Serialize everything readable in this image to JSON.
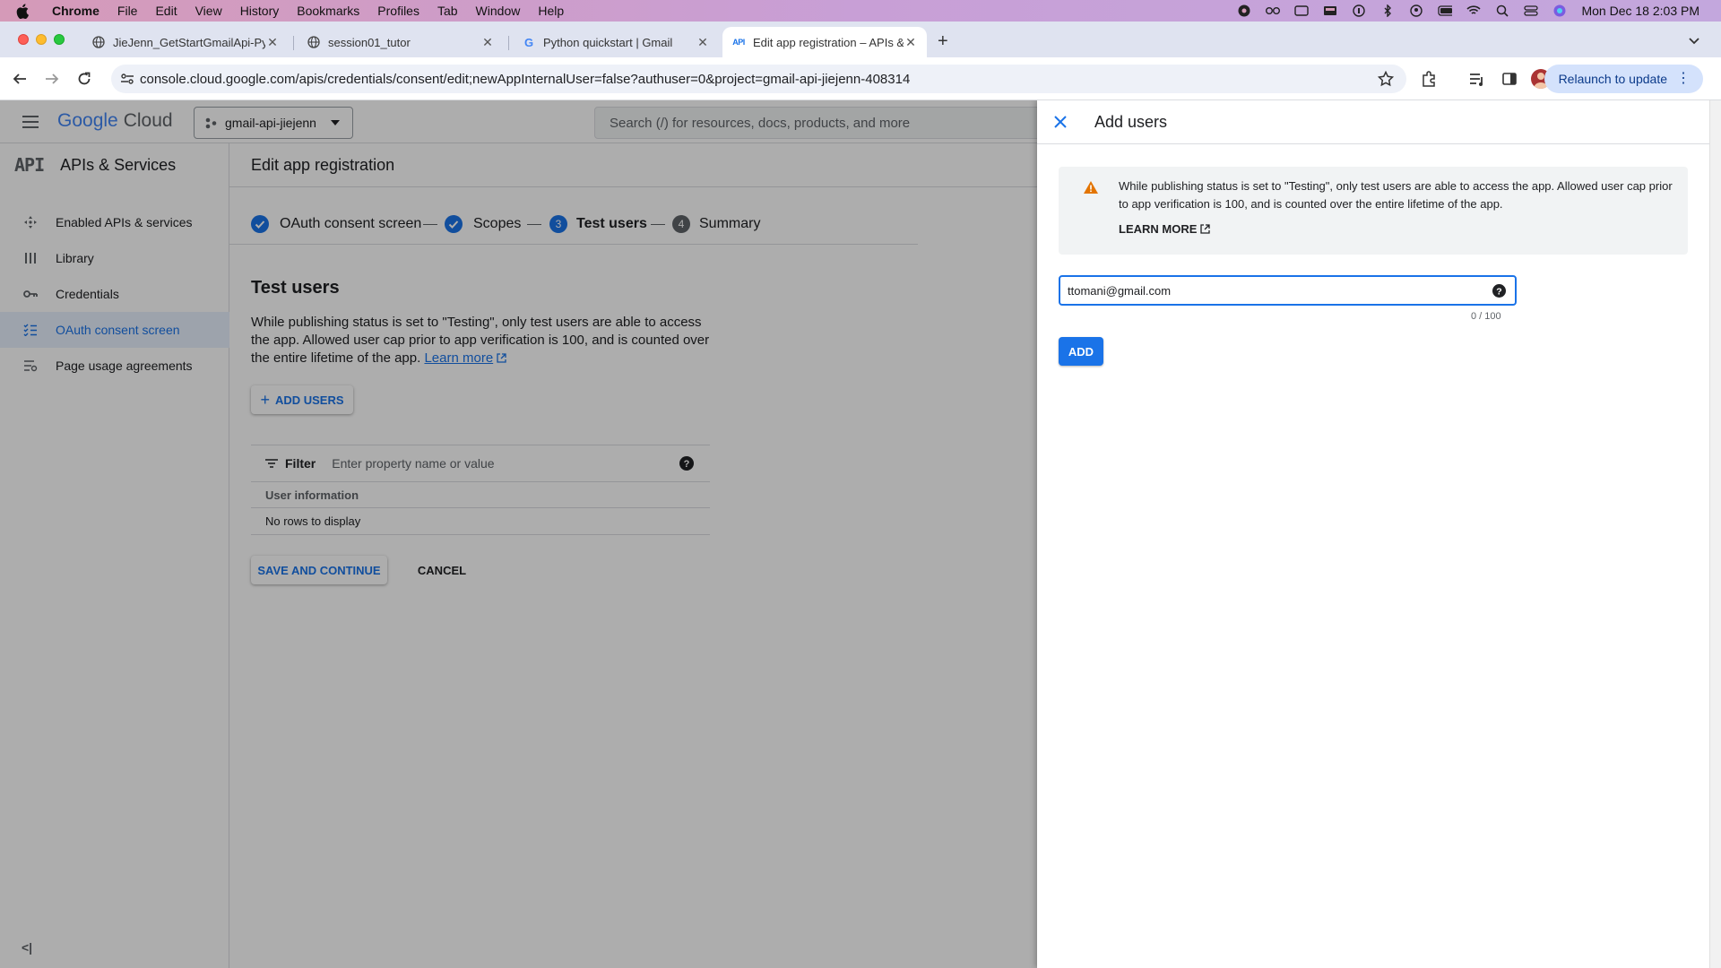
{
  "mac_menu": {
    "app": "Chrome",
    "items": [
      "File",
      "Edit",
      "View",
      "History",
      "Bookmarks",
      "Profiles",
      "Tab",
      "Window",
      "Help"
    ],
    "clock": "Mon Dec 18  2:03 PM"
  },
  "tabs": [
    {
      "title": "JieJenn_GetStartGmailApi-Py",
      "icon": "globe-icon"
    },
    {
      "title": "session01_tutor",
      "icon": "globe-icon"
    },
    {
      "title": "Python quickstart  |  Gmail",
      "icon": "google-g-icon"
    },
    {
      "title": "Edit app registration – APIs &",
      "icon": "api-icon",
      "active": true
    }
  ],
  "toolbar": {
    "url": "console.cloud.google.com/apis/credentials/consent/edit;newAppInternalUser=false?authuser=0&project=gmail-api-jiejenn-408314",
    "relaunch": "Relaunch to update"
  },
  "gcloud": {
    "logo_google": "Google",
    "logo_cloud": "Cloud",
    "project": "gmail-api-jiejenn",
    "search_placeholder": "Search (/) for resources, docs, products, and more"
  },
  "sidebar": {
    "api_badge": "API",
    "title": "APIs & Services",
    "items": [
      {
        "label": "Enabled APIs & services",
        "icon": "enabled-apis-icon"
      },
      {
        "label": "Library",
        "icon": "library-icon"
      },
      {
        "label": "Credentials",
        "icon": "key-icon"
      },
      {
        "label": "OAuth consent screen",
        "icon": "consent-icon",
        "selected": true
      },
      {
        "label": "Page usage agreements",
        "icon": "agreements-icon"
      }
    ],
    "collapse": "<|"
  },
  "main": {
    "page_title": "Edit app registration",
    "steps": [
      {
        "label": "OAuth consent screen",
        "state": "done"
      },
      {
        "label": "Scopes",
        "state": "done"
      },
      {
        "num": "3",
        "label": "Test users",
        "state": "current"
      },
      {
        "num": "4",
        "label": "Summary",
        "state": "todo"
      }
    ],
    "section_title": "Test users",
    "description": "While publishing status is set to \"Testing\", only test users are able to access the app. Allowed user cap prior to app verification is 100, and is counted over the entire lifetime of the app.",
    "learn_more": "Learn more",
    "add_users_button": "ADD USERS",
    "filter_label": "Filter",
    "filter_placeholder": "Enter property name or value",
    "table_header": "User information",
    "empty_text": "No rows to display",
    "save_button": "SAVE AND CONTINUE",
    "cancel_button": "CANCEL"
  },
  "panel": {
    "title": "Add users",
    "banner_text": "While publishing status is set to \"Testing\", only test users are able to access the app. Allowed user cap prior to app verification is 100, and is counted over the entire lifetime of the app.",
    "banner_link": "LEARN MORE",
    "email_value": "ttomani@gmail.com",
    "counter": "0 / 100",
    "add_button": "ADD"
  },
  "colors": {
    "accent": "#1a73e8",
    "warning": "#e37400",
    "step_done": "#1a73e8",
    "step_todo": "#5f6368"
  }
}
